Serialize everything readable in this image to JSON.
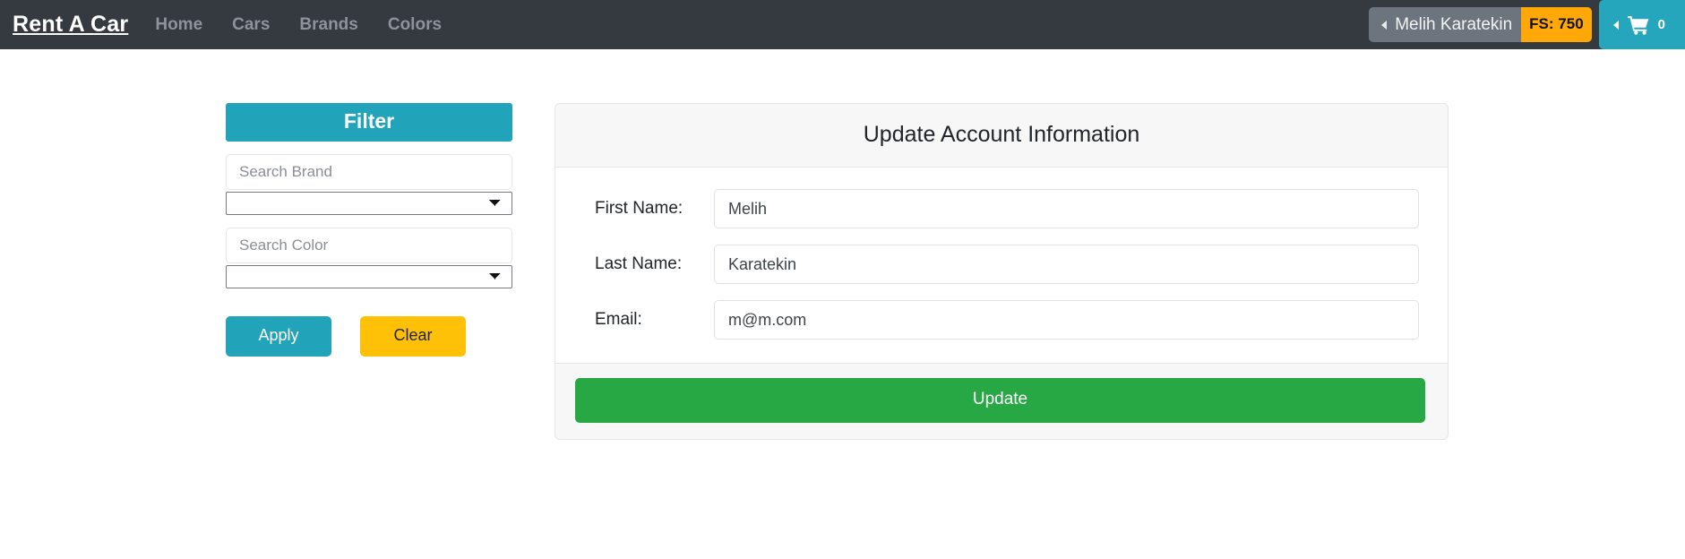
{
  "navbar": {
    "brand": "Rent A Car",
    "links": [
      {
        "label": "Home"
      },
      {
        "label": "Cars"
      },
      {
        "label": "Brands"
      },
      {
        "label": "Colors"
      }
    ],
    "user": {
      "name": "Melih Karatekin",
      "balance_badge": "FS: 750",
      "caret_icon": "caret-left-icon"
    },
    "cart": {
      "count": "0",
      "icon": "shopping-cart-icon",
      "caret_icon": "caret-left-icon"
    },
    "colors": {
      "background": "#343a40",
      "link": "#8d929b",
      "badge": "#ffa807",
      "cart": "#25a6bd"
    }
  },
  "filter": {
    "title": "Filter",
    "brand": {
      "placeholder": "Search Brand",
      "value": "",
      "select_value": "",
      "dropdown_icon": "chevron-down-icon"
    },
    "color": {
      "placeholder": "Search Color",
      "value": "",
      "select_value": "",
      "dropdown_icon": "chevron-down-icon"
    },
    "apply_label": "Apply",
    "clear_label": "Clear",
    "colors": {
      "header": "#21a3ba",
      "apply": "#21a3ba",
      "clear": "#ffc107"
    }
  },
  "account": {
    "title": "Update Account Information",
    "fields": [
      {
        "label": "First Name:",
        "value": "Melih"
      },
      {
        "label": "Last Name:",
        "value": "Karatekin"
      },
      {
        "label": "Email:",
        "value": "m@m.com"
      }
    ],
    "update_label": "Update",
    "colors": {
      "update": "#28a745",
      "header_bg": "#f7f7f7"
    }
  }
}
